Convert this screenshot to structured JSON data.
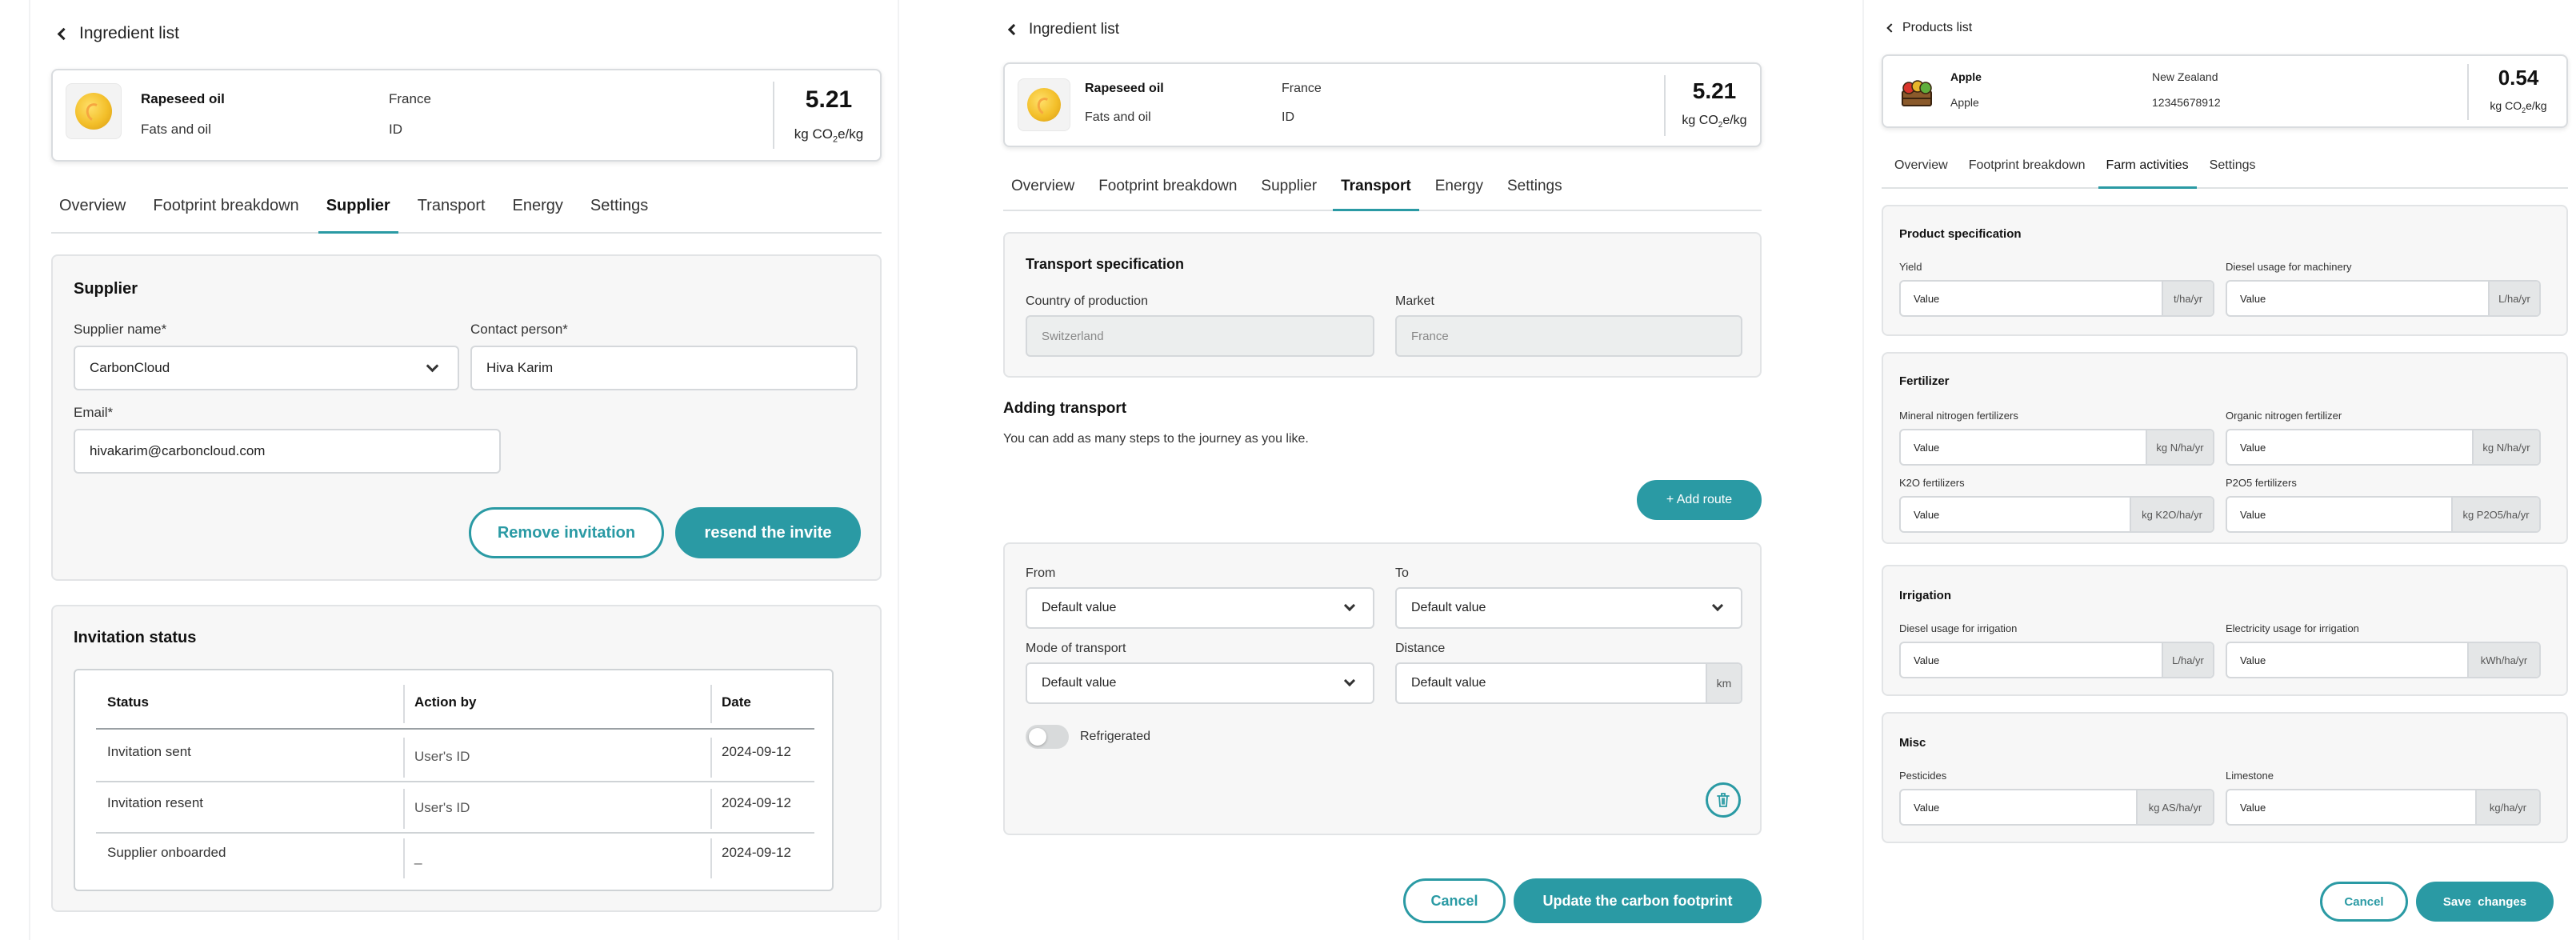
{
  "theme": {
    "accent": "#2a9aa4",
    "section_bg": "#f7f7f7",
    "border": "#d9dcdf"
  },
  "panel1": {
    "back_label": "Ingredient list",
    "header": {
      "name": "Rapeseed oil",
      "category": "Fats and oil",
      "country": "France",
      "id_label": "ID",
      "value": "5.21",
      "unit_prefix": "kg CO",
      "unit_sub": "2",
      "unit_suffix": "e/kg",
      "icon": "oil-drop-icon"
    },
    "tabs": [
      "Overview",
      "Footprint breakdown",
      "Supplier",
      "Transport",
      "Energy",
      "Settings"
    ],
    "active_tab": "Supplier",
    "supplier": {
      "title": "Supplier",
      "supplier_name_label": "Supplier name*",
      "supplier_name_value": "CarbonCloud",
      "contact_label": "Contact person*",
      "contact_value": "Hiva Karim",
      "email_label": "Email*",
      "email_value": "hivakarim@carboncloud.com",
      "remove_button": "Remove invitation",
      "resend_button": "resend the invite"
    },
    "invitation": {
      "title": "Invitation status",
      "headers": [
        "Status",
        "Action by",
        "Date"
      ],
      "rows": [
        {
          "status": "Invitation sent",
          "action_by": "User's ID",
          "date": "2024-09-12"
        },
        {
          "status": "Invitation resent",
          "action_by": "User's ID",
          "date": "2024-09-12"
        },
        {
          "status": "Supplier onboarded",
          "action_by": "_",
          "date": "2024-09-12"
        }
      ]
    }
  },
  "panel2": {
    "back_label": "Ingredient list",
    "header": {
      "name": "Rapeseed oil",
      "category": "Fats and oil",
      "country": "France",
      "id_label": "ID",
      "value": "5.21",
      "unit_prefix": "kg CO",
      "unit_sub": "2",
      "unit_suffix": "e/kg",
      "icon": "oil-drop-icon"
    },
    "tabs": [
      "Overview",
      "Footprint breakdown",
      "Supplier",
      "Transport",
      "Energy",
      "Settings"
    ],
    "active_tab": "Transport",
    "spec": {
      "title": "Transport specification",
      "country_label": "Country of production",
      "country_value": "Switzerland",
      "market_label": "Market",
      "market_value": "France"
    },
    "adding": {
      "title": "Adding transport",
      "description": "You can add as many steps to the journey as you like.",
      "add_route_button": "+ Add route"
    },
    "route": {
      "from_label": "From",
      "from_value": "Default value",
      "to_label": "To",
      "to_value": "Default value",
      "mode_label": "Mode of transport",
      "mode_value": "Default value",
      "distance_label": "Distance",
      "distance_value": "Default value",
      "distance_unit": "km",
      "refrigerated_label": "Refrigerated",
      "refrigerated_on": false
    },
    "cancel_button": "Cancel",
    "update_button": "Update the carbon footprint"
  },
  "panel3": {
    "back_label": "Products list",
    "header": {
      "name": "Apple",
      "category": "Apple",
      "country": "New Zealand",
      "id_value": "12345678912",
      "value": "0.54",
      "unit_prefix": "kg CO",
      "unit_sub": "2",
      "unit_suffix": "e/kg",
      "icon": "apple-crate-icon"
    },
    "tabs": [
      "Overview",
      "Footprint breakdown",
      "Farm activities",
      "Settings"
    ],
    "active_tab": "Farm activities",
    "product_spec": {
      "title": "Product specification",
      "yield_label": "Yield",
      "yield_value": "Value",
      "yield_unit": "t/ha/yr",
      "diesel_label": "Diesel usage for machinery",
      "diesel_value": "Value",
      "diesel_unit": "L/ha/yr"
    },
    "fertilizer": {
      "title": "Fertilizer",
      "mineral_label": "Mineral nitrogen fertilizers",
      "mineral_value": "Value",
      "mineral_unit": "kg N/ha/yr",
      "organic_label": "Organic nitrogen fertilizer",
      "organic_value": "Value",
      "organic_unit": "kg N/ha/yr",
      "k2o_label": "K2O fertilizers",
      "k2o_value": "Value",
      "k2o_unit": "kg K2O/ha/yr",
      "p2o5_label": "P2O5 fertilizers",
      "p2o5_value": "Value",
      "p2o5_unit": "kg P2O5/ha/yr"
    },
    "irrigation": {
      "title": "Irrigation",
      "diesel_label": "Diesel usage for irrigation",
      "diesel_value": "Value",
      "diesel_unit": "L/ha/yr",
      "electricity_label": "Electricity usage for irrigation",
      "electricity_value": "Value",
      "electricity_unit": "kWh/ha/yr"
    },
    "misc": {
      "title": "Misc",
      "pesticides_label": "Pesticides",
      "pesticides_value": "Value",
      "pesticides_unit": "kg AS/ha/yr",
      "limestone_label": "Limestone",
      "limestone_value": "Value",
      "limestone_unit": "kg/ha/yr"
    },
    "cancel_button": "Cancel",
    "save_button": "Save  changes"
  }
}
